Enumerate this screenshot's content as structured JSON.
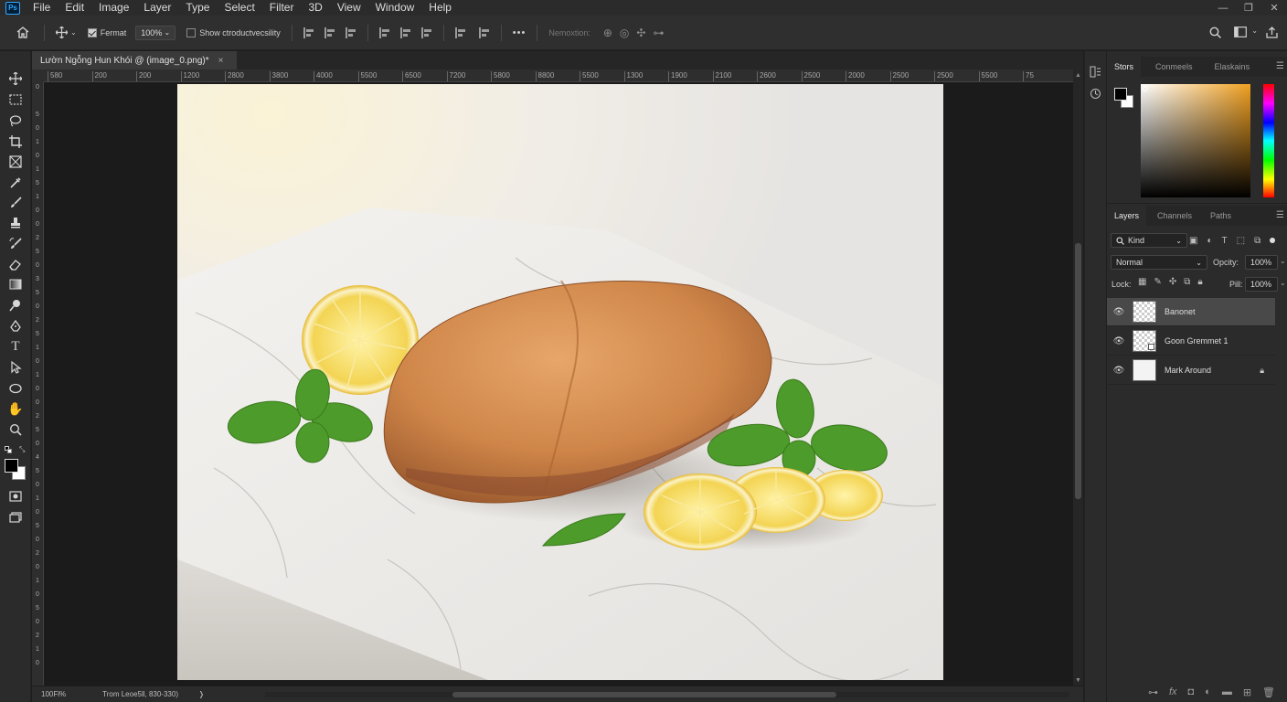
{
  "app": {
    "logo": "Ps"
  },
  "menu": [
    "File",
    "Edit",
    "Image",
    "Layer",
    "Type",
    "Select",
    "Filter",
    "3D",
    "View",
    "Window",
    "Help"
  ],
  "window_controls": {
    "minimize": "—",
    "restore": "❐",
    "close": "✕"
  },
  "options": {
    "format_label": "Fermat",
    "zoom_value": "100%",
    "show_label": "Show ctroductvecsility",
    "nemoxtion_label": "Nemoxtion:",
    "more": "•••"
  },
  "document": {
    "tab_title": "Lườn Ngỗng Hun Khói @ (image_0.png)*",
    "close": "×"
  },
  "rulers": {
    "top": [
      "580",
      "200",
      "200",
      "1200",
      "2800",
      "3800",
      "4000",
      "5500",
      "6500",
      "7200",
      "5800",
      "8800",
      "5500",
      "1300",
      "1900",
      "2100",
      "2600",
      "2500",
      "2000",
      "2500",
      "2500",
      "5500",
      "75"
    ],
    "left": [
      "0",
      "",
      "5",
      "0",
      "1",
      "0",
      "1",
      "5",
      "1",
      "0",
      "0",
      "2",
      "5",
      "0",
      "3",
      "5",
      "0",
      "2",
      "5",
      "1",
      "0",
      "1",
      "0",
      "0",
      "2",
      "5",
      "0",
      "4",
      "5",
      "0",
      "1",
      "0",
      "5",
      "0",
      "2",
      "0",
      "1",
      "0",
      "5",
      "0",
      "2",
      "1",
      "0"
    ]
  },
  "status": {
    "zoom": "100Fl%",
    "info": "Trom Leoe5ll, 830-330)",
    "arrow": "❭"
  },
  "color_panel": {
    "tabs": [
      "Stors",
      "Conmeels",
      "Elaskains"
    ]
  },
  "layers_panel": {
    "tabs": [
      "Layers",
      "Channels",
      "Paths"
    ],
    "filter": "Kind",
    "blend_mode": "Normal",
    "opacity_label": "Opcity:",
    "opacity_value": "100%",
    "lock_label": "Lock:",
    "fill_label": "Pill:",
    "fill_value": "100%",
    "layers": [
      {
        "name": "Banonet",
        "selected": true,
        "thumb": "checker"
      },
      {
        "name": "Goon Gremmet 1",
        "selected": false,
        "thumb": "checker"
      },
      {
        "name": "Mark Around",
        "selected": false,
        "thumb": "white",
        "locked": true
      }
    ]
  }
}
